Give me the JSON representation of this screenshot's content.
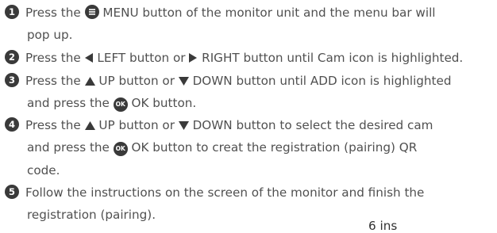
{
  "steps": [
    {
      "number": "1",
      "l1_a": "Press the",
      "l1_b": "MENU button of the monitor unit and the menu bar will",
      "l2": "pop up."
    },
    {
      "number": "2",
      "l1_a": "Press the",
      "l1_b": "LEFT button or",
      "l1_c": "RIGHT button until  Cam icon is  highlighted."
    },
    {
      "number": "3",
      "l1_a": "Press the",
      "l1_b": "UP button or",
      "l1_c": "DOWN button until ADD icon is highlighted",
      "l2_a": "and press the",
      "ok_icon_text": "OK",
      "l2_b": "OK button."
    },
    {
      "number": "4",
      "l1_a": "Press the",
      "l1_b": "UP button or",
      "l1_c": "DOWN button to select the desired cam",
      "l2_a": "and press the",
      "ok_icon_text": "OK",
      "l2_b": "OK button to creat the registration (pairing) QR",
      "l3": "code."
    },
    {
      "number": "5",
      "l1": "Follow the instructions on the screen of the monitor and finish the",
      "l2": "registration (pairing)."
    }
  ],
  "footer_text": "6 ins",
  "icons": {
    "menu": "menu-lines-icon",
    "left": "left-triangle-icon",
    "right": "right-triangle-icon",
    "up": "up-triangle-icon",
    "down": "down-triangle-icon",
    "ok": "ok-badge-icon"
  },
  "colors": {
    "text": "#505050",
    "icon": "#3a3a3a"
  }
}
